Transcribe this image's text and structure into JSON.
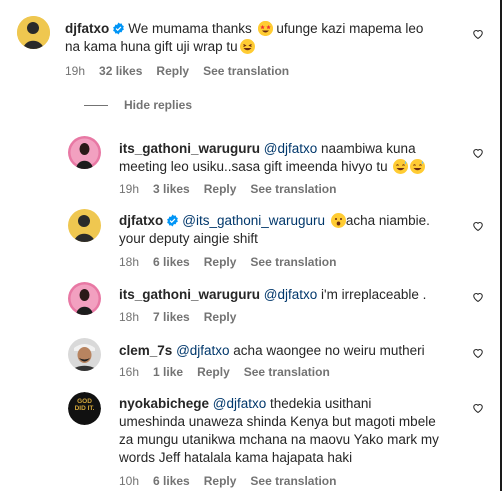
{
  "comments": [
    {
      "username": "djfatxo",
      "verified": true,
      "mention": "",
      "text": "We mumama thanks",
      "text2": " ufunge kazi mapema leo na kama huna gift uji wrap tu",
      "emoji1": "star-struck",
      "emoji2": "laughing",
      "time": "19h",
      "likes": "32 likes",
      "reply": "Reply",
      "translate": "See translation"
    },
    {
      "username": "its_gathoni_waruguru",
      "verified": false,
      "mention": "@djfatxo",
      "text": " naambiwa kuna meeting leo usiku..sasa gift imeenda hivyo tu",
      "time": "19h",
      "likes": "3 likes",
      "reply": "Reply",
      "translate": "See translation"
    },
    {
      "username": "djfatxo",
      "verified": true,
      "mention": "@its_gathoni_waruguru",
      "text": "acha niambie. your deputy aingie shift",
      "time": "18h",
      "likes": "6 likes",
      "reply": "Reply",
      "translate": "See translation"
    },
    {
      "username": "its_gathoni_waruguru",
      "verified": false,
      "mention": "@djfatxo",
      "text": " i'm irreplaceable .",
      "time": "18h",
      "likes": "7 likes",
      "reply": "Reply"
    },
    {
      "username": "clem_7s",
      "verified": false,
      "mention": "@djfatxo",
      "text": " acha waongee no weiru mutheri",
      "time": "16h",
      "likes": "1 like",
      "reply": "Reply",
      "translate": "See translation"
    },
    {
      "username": "nyokabichege",
      "verified": false,
      "mention": "@djfatxo",
      "text": " thedekia usithani umeshinda unaweza shinda Kenya but magoti mbele za mungu utanikwa mchana na maovu Yako mark my words Jeff hatalala kama hajapata haki",
      "time": "10h",
      "likes": "6 likes",
      "reply": "Reply",
      "translate": "See translation"
    }
  ],
  "hide_replies": "Hide replies",
  "avatar_text": "GOD DID IT.",
  "colors": {
    "text": "#262626",
    "secondary": "#737373",
    "mention": "#00376b",
    "verified": "#0095f6"
  }
}
